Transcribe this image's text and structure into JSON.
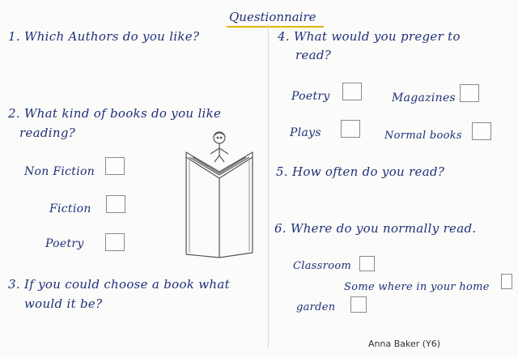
{
  "title": "Questionnaire",
  "questions": [
    {
      "number": "1.",
      "text": "Which Authors do you like?"
    },
    {
      "number": "2.",
      "line1": "What kind of books do you like",
      "line2": "reading?"
    },
    {
      "number": "3.",
      "line1": "If you could choose a book what",
      "line2": "would it be?"
    },
    {
      "number": "4.",
      "line1": "What would you preger to",
      "line2": "read?"
    },
    {
      "number": "5.",
      "text": "How often do you read?"
    },
    {
      "number": "6.",
      "text": "Where do you normally read."
    }
  ],
  "q2_options": [
    "Non Fiction",
    "Fiction",
    "Poetry"
  ],
  "q4_options": [
    "Poetry",
    "Magazines",
    "Plays",
    "Normal books"
  ],
  "q6_options": [
    "Classroom",
    "Some where in your home",
    "garden"
  ],
  "signature": "Anna Baker (Y6)",
  "colors": {
    "ink": "#1f2f7a",
    "title_underline": "#e2b400",
    "pencil": "#555555"
  }
}
